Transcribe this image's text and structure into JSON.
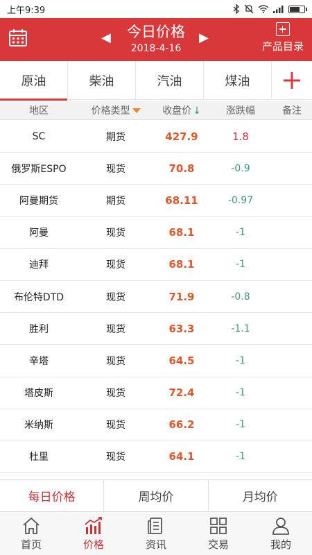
{
  "status_bar": {
    "time": "上午9:39"
  },
  "header": {
    "title": "今日价格",
    "date": "2018-4-16",
    "prev_symbol": "◀",
    "next_symbol": "▶",
    "catalog_label": "产品目录",
    "background_color": "#d8383a"
  },
  "tabs": [
    {
      "label": "原油",
      "active": true
    },
    {
      "label": "柴油"
    },
    {
      "label": "汽油"
    },
    {
      "label": "煤油"
    }
  ],
  "table": {
    "columns": [
      "地区",
      "价格类型",
      "收盘价",
      "涨跌幅",
      "备注"
    ],
    "sort_arrow": "↓",
    "rows": [
      {
        "region": "SC",
        "type": "期货",
        "close": "427.9",
        "change": "1.8"
      },
      {
        "region": "俄罗斯ESPO",
        "type": "现货",
        "close": "70.8",
        "change": "-0.9"
      },
      {
        "region": "阿曼期货",
        "type": "期货",
        "close": "68.11",
        "change": "-0.97"
      },
      {
        "region": "阿曼",
        "type": "现货",
        "close": "68.1",
        "change": "-1"
      },
      {
        "region": "迪拜",
        "type": "现货",
        "close": "68.1",
        "change": "-1"
      },
      {
        "region": "布伦特DTD",
        "type": "现货",
        "close": "71.9",
        "change": "-0.8"
      },
      {
        "region": "胜利",
        "type": "现货",
        "close": "63.3",
        "change": "-1.1"
      },
      {
        "region": "辛塔",
        "type": "现货",
        "close": "64.5",
        "change": "-1"
      },
      {
        "region": "塔皮斯",
        "type": "现货",
        "close": "72.4",
        "change": "-1"
      },
      {
        "region": "米纳斯",
        "type": "现货",
        "close": "66.2",
        "change": "-1"
      },
      {
        "region": "杜里",
        "type": "现货",
        "close": "64.1",
        "change": "-1"
      }
    ]
  },
  "period_tabs": [
    {
      "label": "每日价格",
      "active": true
    },
    {
      "label": "周均价"
    },
    {
      "label": "月均价"
    }
  ],
  "bottom_nav": [
    {
      "label": "首页",
      "icon": "home-icon"
    },
    {
      "label": "价格",
      "icon": "price-chart-icon",
      "active": true
    },
    {
      "label": "资讯",
      "icon": "news-icon"
    },
    {
      "label": "交易",
      "icon": "grid-icon"
    },
    {
      "label": "我的",
      "icon": "user-icon"
    }
  ],
  "colors": {
    "accent": "#d8383a",
    "price": "#e1572a",
    "up": "#c8323a",
    "down": "#3f9a78",
    "sort": "#f0862a"
  }
}
